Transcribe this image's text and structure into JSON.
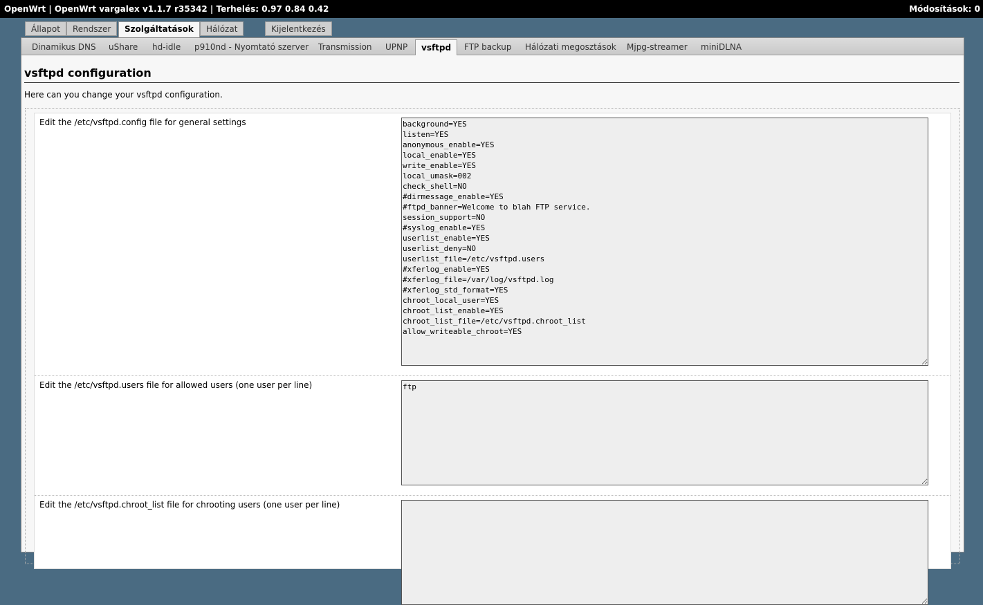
{
  "header": {
    "title": "OpenWrt | OpenWrt vargalex v1.1.7 r35342 | Terhelés: 0.97 0.84 0.42",
    "changes": "Módosítások: 0"
  },
  "main_tabs": [
    {
      "label": "Állapot",
      "active": false
    },
    {
      "label": "Rendszer",
      "active": false
    },
    {
      "label": "Szolgáltatások",
      "active": true
    },
    {
      "label": "Hálózat",
      "active": false
    },
    {
      "label": "Kijelentkezés",
      "active": false
    }
  ],
  "sub_tabs": [
    {
      "label": "Dinamikus DNS",
      "active": false
    },
    {
      "label": "uShare",
      "active": false
    },
    {
      "label": "hd-idle",
      "active": false
    },
    {
      "label": "p910nd - Nyomtató szerver",
      "active": false
    },
    {
      "label": "Transmission",
      "active": false
    },
    {
      "label": "UPNP",
      "active": false
    },
    {
      "label": "vsftpd",
      "active": true
    },
    {
      "label": "FTP backup",
      "active": false
    },
    {
      "label": "Hálózati megosztások",
      "active": false
    },
    {
      "label": "Mjpg-streamer",
      "active": false
    },
    {
      "label": "miniDLNA",
      "active": false
    }
  ],
  "page": {
    "title": "vsftpd configuration",
    "description": "Here can you change your vsftpd configuration."
  },
  "fields": [
    {
      "label": "Edit the /etc/vsftpd.config file for general settings",
      "value": "background=YES\nlisten=YES\nanonymous_enable=YES\nlocal_enable=YES\nwrite_enable=YES\nlocal_umask=002\ncheck_shell=NO\n#dirmessage_enable=YES\n#ftpd_banner=Welcome to blah FTP service.\nsession_support=NO\n#syslog_enable=YES\nuserlist_enable=YES\nuserlist_deny=NO\nuserlist_file=/etc/vsftpd.users\n#xferlog_enable=YES\n#xferlog_file=/var/log/vsftpd.log\n#xferlog_std_format=YES\nchroot_local_user=YES\nchroot_list_enable=YES\nchroot_list_file=/etc/vsftpd.chroot_list\nallow_writeable_chroot=YES"
    },
    {
      "label": "Edit the /etc/vsftpd.users file for allowed users (one user per line)",
      "value": "ftp"
    },
    {
      "label": "Edit the /etc/vsftpd.chroot_list file for chrooting users (one user per line)",
      "value": ""
    }
  ],
  "colors": {
    "background": "#4a6b82",
    "topbar": "#000000",
    "panel": "#f7f7f7",
    "textarea": "#eeeeee"
  }
}
